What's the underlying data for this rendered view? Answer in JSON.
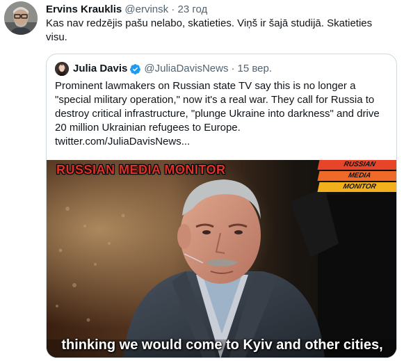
{
  "tweet": {
    "author_name": "Ervins Krauklis",
    "author_handle": "@ervinsk",
    "separator": "·",
    "time": "23 год",
    "text": "Kas nav redzējis pašu nelabo, skatieties. Viņš ir šajā studijā. Skatieties visu."
  },
  "quoted_tweet": {
    "author_name": "Julia Davis",
    "author_handle": "@JuliaDavisNews",
    "separator": "·",
    "time": "15 вер.",
    "text": "Prominent lawmakers on Russian state TV say this is no longer a \"special military operation,\" now it's a real war. They call for Russia to destroy critical infrastructure, \"plunge Ukraine into darkness\" and drive 20 million Ukrainian refugees to Europe.",
    "link": "twitter.com/JuliaDavisNews...",
    "media": {
      "overlay_title": "RUSSIAN MEDIA MONITOR",
      "banner_lines": [
        "RUSSIAN",
        "MEDIA",
        "MONITOR"
      ],
      "caption": "thinking we would come to Kyiv and other cities,"
    }
  },
  "colors": {
    "text": "#0f1419",
    "secondary": "#536471",
    "border": "#cfd9de",
    "verified": "#1d9bf0",
    "overlay_title": "#e0322a"
  },
  "icons": [
    "user-avatar",
    "verified-badge-icon"
  ]
}
